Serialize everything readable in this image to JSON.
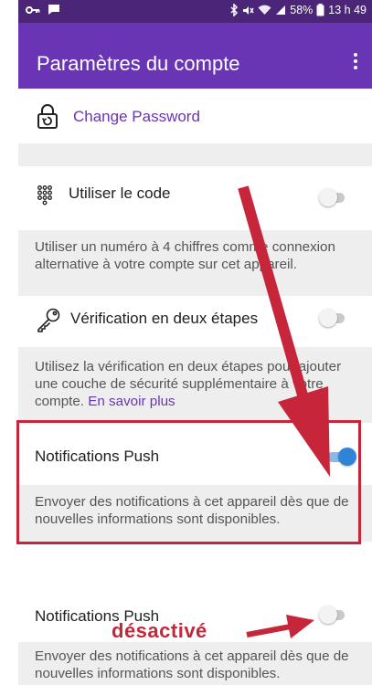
{
  "status_bar": {
    "battery_percent": "58%",
    "time": "13 h 49",
    "icons": [
      "key-icon",
      "message-icon",
      "bluetooth-icon",
      "mute-icon",
      "wifi-icon",
      "signal-icon",
      "battery-icon"
    ]
  },
  "app_bar": {
    "title": "Paramètres du compte",
    "menu_icon": "more-vert-icon"
  },
  "settings": {
    "change_password": {
      "label": "Change Password",
      "icon": "lock-reset-icon"
    },
    "use_code": {
      "label": "Utiliser le code",
      "icon": "keypad-icon",
      "enabled": false,
      "description": "Utiliser un numéro à 4 chiffres comme connexion alternative à votre compte sur cet appareil."
    },
    "two_step": {
      "label": "Vérification en deux étapes",
      "icon": "key-icon",
      "enabled": false,
      "description": "Utilisez la vérification en deux étapes pour ajouter une couche de sécurité supplémentaire à votre compte. ",
      "link": "En savoir plus"
    },
    "push_on": {
      "label": "Notifications Push",
      "enabled": true,
      "description": "Envoyer des notifications à cet appareil dès que de nouvelles informations sont disponibles."
    },
    "push_off": {
      "label": "Notifications Push",
      "enabled": false,
      "description": "Envoyer des notifications à cet appareil dès que de nouvelles informations sont disponibles."
    }
  },
  "annotation": {
    "label": "désactivé",
    "color": "#c7253a"
  },
  "colors": {
    "status_bar": "#4a2578",
    "app_bar": "#6935b4",
    "accent": "#2f84d8",
    "link": "#6935b4"
  }
}
